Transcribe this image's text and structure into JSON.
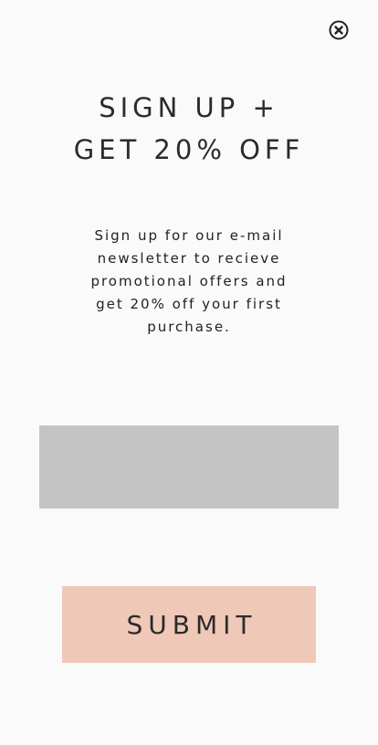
{
  "modal": {
    "close_icon": "close-circle-icon",
    "title_lines": [
      "SIGN UP +",
      "GET 20% OFF"
    ],
    "description_lines": [
      "Sign up for our e-mail",
      "newsletter to recieve",
      "promotional offers and",
      "get 20% off your first",
      "purchase."
    ],
    "email": {
      "value": "",
      "placeholder": ""
    },
    "submit_label": "SUBMIT"
  },
  "colors": {
    "background": "#fafafa",
    "text": "#2b2b2b",
    "input_fill": "#c4c4c4",
    "submit_fill": "#efc8b7"
  }
}
